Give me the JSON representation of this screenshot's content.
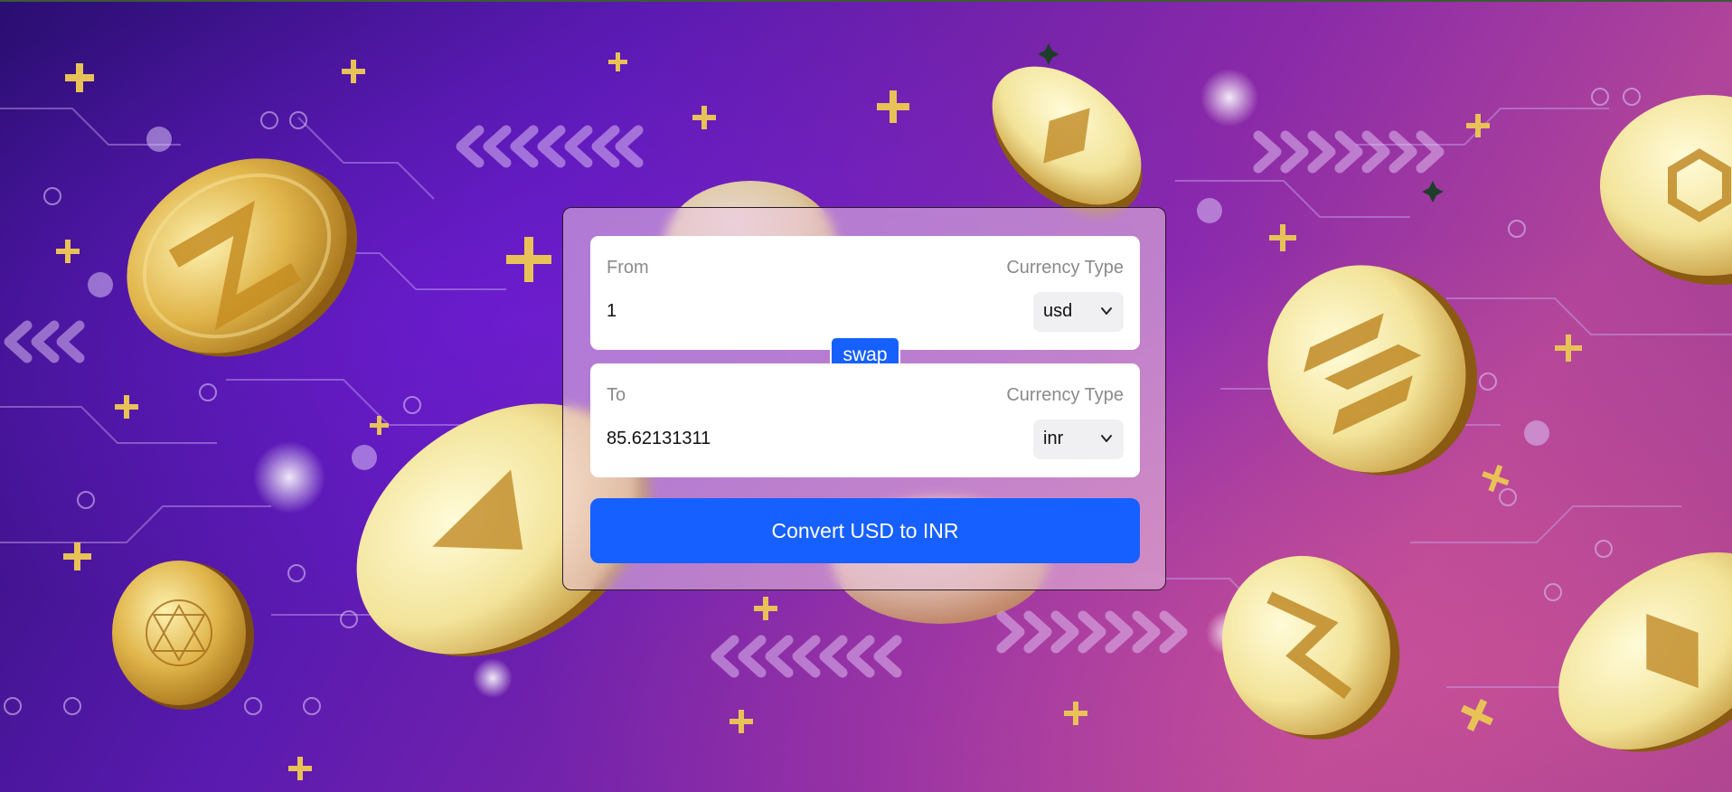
{
  "converter": {
    "from_label": "From",
    "from_type_label": "Currency Type",
    "from_amount": "1",
    "from_currency": "usd",
    "swap_label": "swap",
    "to_label": "To",
    "to_type_label": "Currency Type",
    "to_amount": "85.62131311",
    "to_currency": "inr",
    "convert_label": "Convert USD to INR"
  },
  "background": {
    "description_icon": "crypto-coins-background",
    "colors": {
      "deep_purple": "#2a0e72",
      "violet": "#5a1ab0",
      "magenta": "#b0449a",
      "coin_gold": "#d9a93a"
    }
  },
  "theme": {
    "accent": "#1660ff",
    "card_tint": "#ecc8e1"
  }
}
